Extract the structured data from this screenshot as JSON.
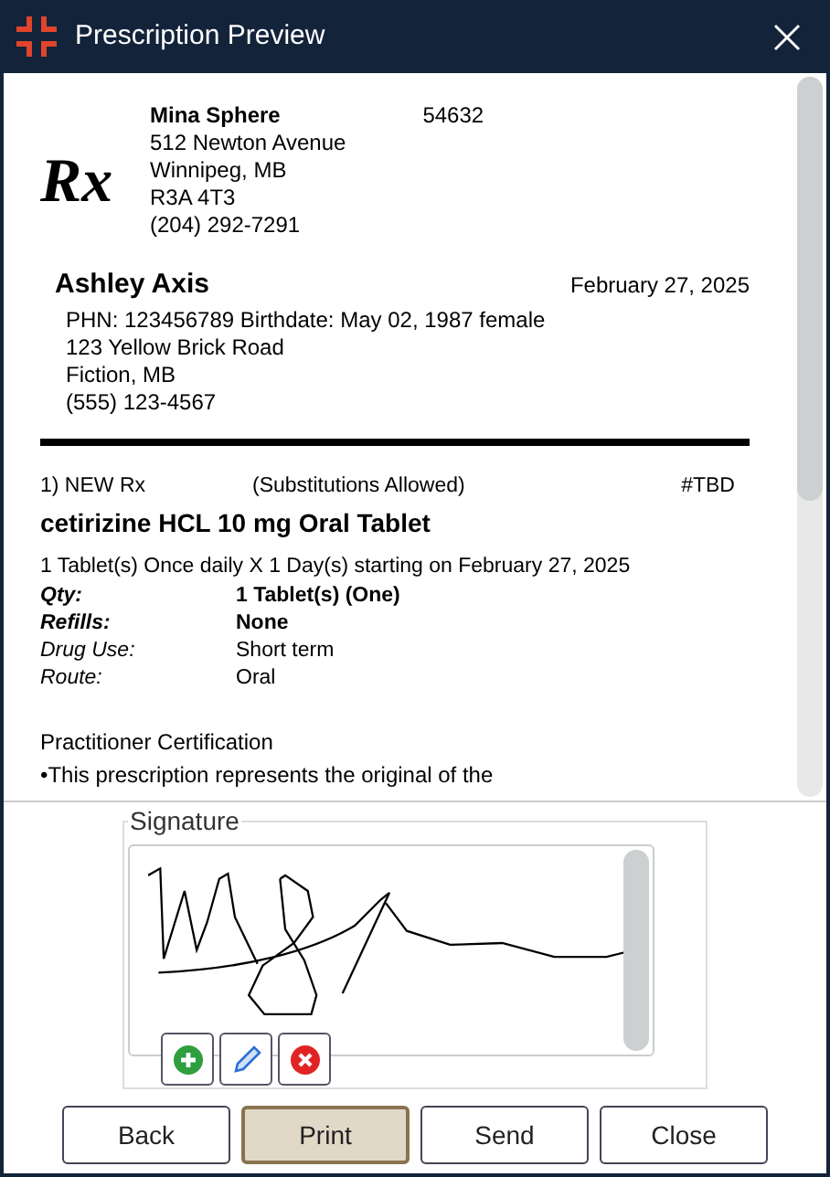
{
  "window": {
    "title": "Prescription Preview"
  },
  "prescriber": {
    "logo": "Rx",
    "name": "Mina Sphere",
    "number": "54632",
    "lines": [
      "512 Newton Avenue",
      "Winnipeg, MB",
      "R3A 4T3",
      "(204) 292-7291"
    ]
  },
  "patient": {
    "name": "Ashley Axis",
    "date": "February 27, 2025",
    "lines": [
      "PHN: 123456789 Birthdate: May 02, 1987 female",
      "123 Yellow Brick Road",
      "Fiction, MB",
      "(555) 123-4567"
    ]
  },
  "prescription": {
    "number": "1) NEW Rx",
    "substitution": "(Substitutions Allowed)",
    "rx_id": "#TBD",
    "drug": "cetirizine HCL 10 mg Oral Tablet",
    "directions": "1 Tablet(s) Once daily X 1 Day(s) starting on February 27, 2025",
    "fields": [
      {
        "label": "Qty:",
        "value": "1 Tablet(s) (One)",
        "kind": "bold"
      },
      {
        "label": "Refills:",
        "value": "None",
        "kind": "bold"
      },
      {
        "label": "Drug Use:",
        "value": "Short term",
        "kind": "italic"
      },
      {
        "label": "Route:",
        "value": "Oral",
        "kind": "italic"
      }
    ]
  },
  "certification": {
    "heading": "Practitioner Certification",
    "text": "•This prescription represents the original of the"
  },
  "signature": {
    "legend": "Signature"
  },
  "buttons": [
    {
      "label": "Back",
      "selected": false
    },
    {
      "label": "Print",
      "selected": true
    },
    {
      "label": "Send",
      "selected": false
    },
    {
      "label": "Close",
      "selected": false
    }
  ]
}
